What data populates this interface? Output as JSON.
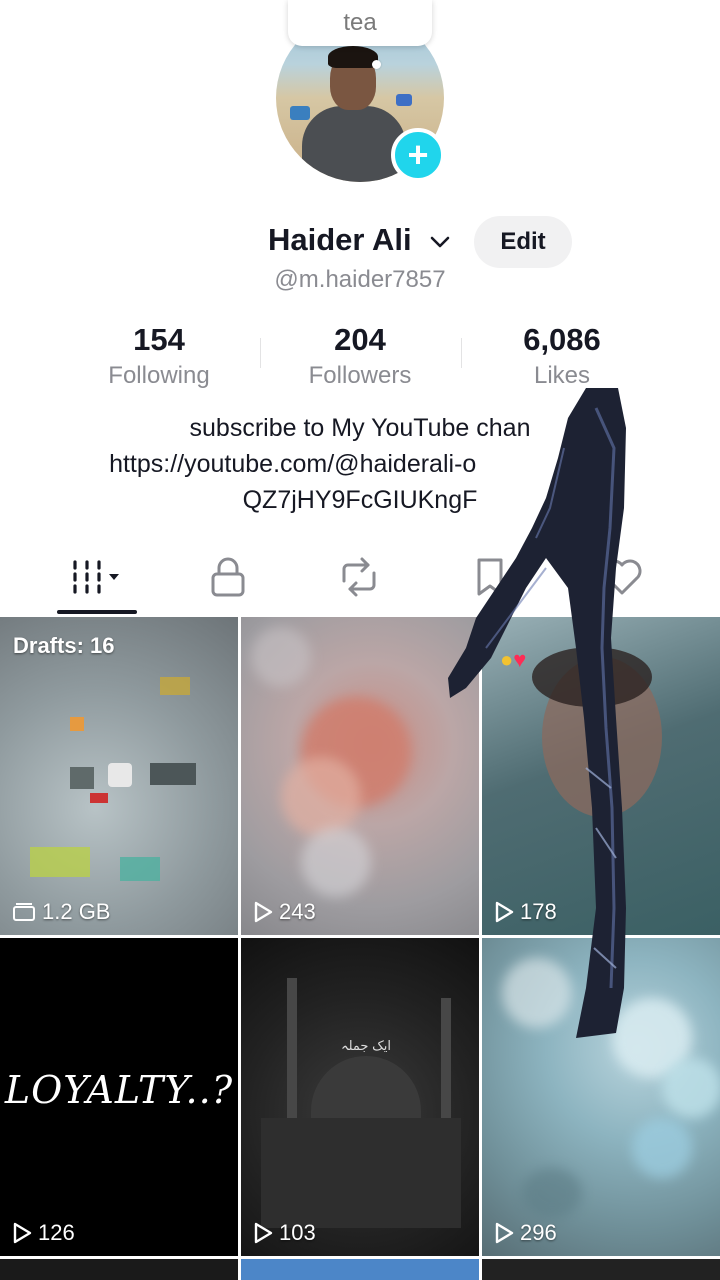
{
  "note": {
    "text": "tea"
  },
  "profile": {
    "name": "Haider Ali",
    "handle": "@m.haider7857",
    "edit_label": "Edit"
  },
  "stats": [
    {
      "value": "154",
      "label": "Following"
    },
    {
      "value": "204",
      "label": "Followers"
    },
    {
      "value": "6,086",
      "label": "Likes"
    }
  ],
  "bio": {
    "line1": "subscribe to My YouTube chan",
    "line2": "https://youtube.com/@haiderali-o",
    "line2_tail": "=",
    "line3": "QZ7jHY9FcGIUKngF"
  },
  "tabs": [
    {
      "name": "videos",
      "icon": "grid-icon",
      "active": true
    },
    {
      "name": "private",
      "icon": "lock-icon",
      "active": false
    },
    {
      "name": "reposts",
      "icon": "repost-icon",
      "active": false
    },
    {
      "name": "favorites",
      "icon": "bookmark-icon",
      "active": false
    },
    {
      "name": "liked",
      "icon": "heart-icon",
      "active": false
    }
  ],
  "grid": {
    "drafts_label": "Drafts: 16",
    "drafts_size": "1.2 GB",
    "views": [
      "243",
      "178",
      "126",
      "103",
      "296"
    ],
    "loyalty_text": "LOYALTY..?",
    "mosque_caption": "ایک جملہ"
  },
  "colors": {
    "accent": "#20d5ec",
    "text_primary": "#161823",
    "text_secondary": "#8a8b91",
    "heart": "#fe2c55"
  }
}
